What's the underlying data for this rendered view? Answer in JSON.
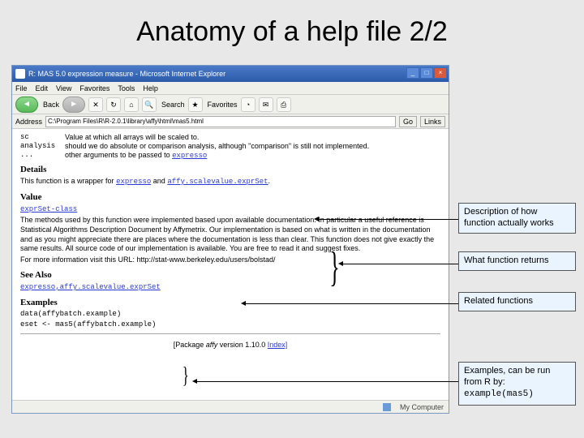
{
  "slide": {
    "title": "Anatomy of a help file 2/2"
  },
  "window": {
    "title": "R: MAS 5.0 expression measure - Microsoft Internet Explorer",
    "menu": [
      "File",
      "Edit",
      "View",
      "Favorites",
      "Tools",
      "Help"
    ],
    "back_label": "Back",
    "search_label": "Search",
    "favorites_label": "Favorites",
    "address_label": "Address",
    "url": "C:\\Program Files\\R\\R-2.0.1\\library\\affy\\html\\mas5.html",
    "go_label": "Go",
    "links_label": "Links",
    "status_zone": "My Computer"
  },
  "help": {
    "args": [
      {
        "name": "sc",
        "desc": "Value at which all arrays will be scaled to."
      },
      {
        "name": "analysis",
        "desc": "should we do absolute or comparison analysis, although \"comparison\" is still not implemented."
      },
      {
        "name": "...",
        "desc": "other arguments to be passed to "
      }
    ],
    "expresso_link": "expresso",
    "sections": {
      "details": "Details",
      "value": "Value",
      "seealso": "See Also",
      "examples": "Examples"
    },
    "details_text_pre": "This function is a wrapper for ",
    "details_text_mid": " and ",
    "details_affy_link": "affy.scalevalue.exprSet",
    "value_link": "exprSet-class",
    "value_para": "The methods used by this function were implemented based upon available documentation. In particular a useful reference is Statistical Algorithms Description Document by Affymetrix. Our implementation is based on what is written in the documentation and as you might appreciate there are places where the documentation is less than clear. This function does not give exactly the same results. All source code of our implementation is available. You are free to read it and suggest fixes.",
    "value_para2_pre": "For more information visit this URL: ",
    "value_url": "http://stat-www.berkeley.edu/users/bolstad/",
    "seealso_links": "expresso,affy.scalevalue.exprSet",
    "example_lines": [
      "data(affybatch.example)",
      "eset <- mas5(affybatch.example)"
    ],
    "footer_pre": "[Package ",
    "footer_pkg": "affy",
    "footer_mid": " version 1.10.0 ",
    "footer_index": "Index]"
  },
  "callouts": {
    "c1": "Description of how function actually works",
    "c2": "What function returns",
    "c3": "Related functions",
    "c4_line1": "Examples, can be run from R by:",
    "c4_code": "example(mas5)"
  }
}
